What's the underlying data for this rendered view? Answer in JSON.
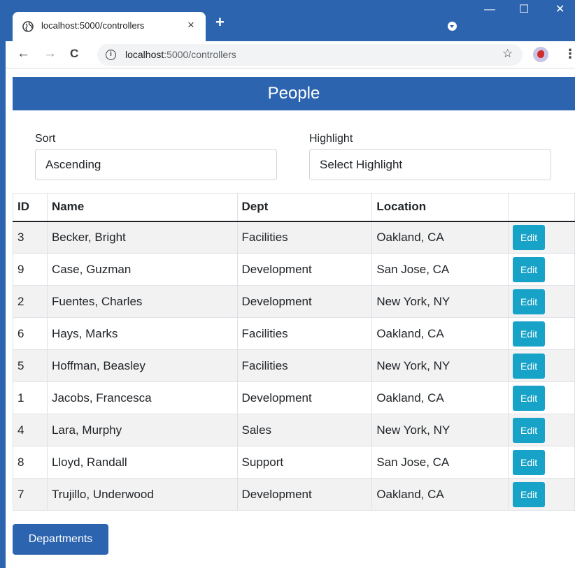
{
  "browser": {
    "tab_title": "localhost:5000/controllers",
    "tab_close": "×",
    "new_tab": "+",
    "url_host": "localhost",
    "url_path": ":5000/controllers",
    "window_controls": {
      "minimize": "—",
      "maximize": "☐",
      "close": "✕"
    },
    "nav": {
      "back": "←",
      "forward": "→",
      "reload": "C"
    }
  },
  "page": {
    "title": "People",
    "sort": {
      "label": "Sort",
      "value": "Ascending"
    },
    "highlight": {
      "label": "Highlight",
      "value": "Select Highlight"
    },
    "table": {
      "headers": [
        "ID",
        "Name",
        "Dept",
        "Location",
        ""
      ],
      "edit_label": "Edit",
      "rows": [
        {
          "id": "3",
          "name": "Becker, Bright",
          "dept": "Facilities",
          "location": "Oakland, CA"
        },
        {
          "id": "9",
          "name": "Case, Guzman",
          "dept": "Development",
          "location": "San Jose, CA"
        },
        {
          "id": "2",
          "name": "Fuentes, Charles",
          "dept": "Development",
          "location": "New York, NY"
        },
        {
          "id": "6",
          "name": "Hays, Marks",
          "dept": "Facilities",
          "location": "Oakland, CA"
        },
        {
          "id": "5",
          "name": "Hoffman, Beasley",
          "dept": "Facilities",
          "location": "New York, NY"
        },
        {
          "id": "1",
          "name": "Jacobs, Francesca",
          "dept": "Development",
          "location": "Oakland, CA"
        },
        {
          "id": "4",
          "name": "Lara, Murphy",
          "dept": "Sales",
          "location": "New York, NY"
        },
        {
          "id": "8",
          "name": "Lloyd, Randall",
          "dept": "Support",
          "location": "San Jose, CA"
        },
        {
          "id": "7",
          "name": "Trujillo, Underwood",
          "dept": "Development",
          "location": "Oakland, CA"
        }
      ]
    },
    "departments_button": "Departments"
  },
  "colors": {
    "brand": "#2c64b0",
    "edit_button": "#17a2c8",
    "stripe": "#f2f2f2"
  },
  "icons": [
    "globe-icon",
    "close-icon",
    "plus-icon",
    "back-arrow-icon",
    "forward-arrow-icon",
    "reload-icon",
    "info-icon",
    "star-icon",
    "avatar",
    "more-menu-icon"
  ]
}
